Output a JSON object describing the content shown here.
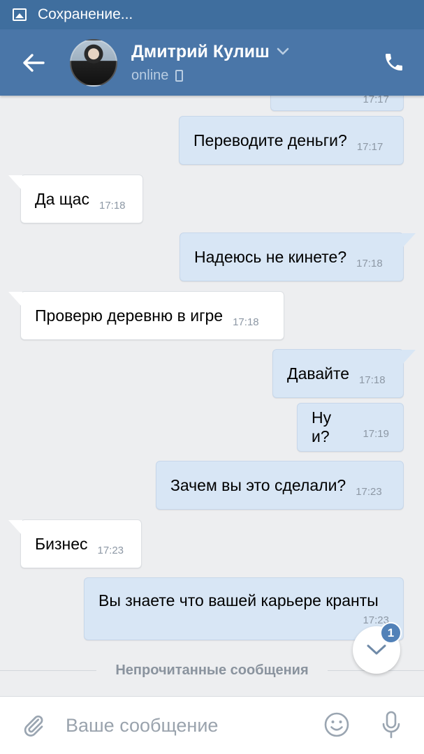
{
  "status_bar": {
    "text": "Сохранение..."
  },
  "header": {
    "contact_name": "Дмитрий Кулиш",
    "presence": "online"
  },
  "messages": [
    {
      "dir": "out",
      "text": "",
      "time": "17:17"
    },
    {
      "dir": "out",
      "text": "Переводите деньги?",
      "time": "17:17"
    },
    {
      "dir": "in",
      "text": "Да щас",
      "time": "17:18"
    },
    {
      "dir": "out",
      "text": "Надеюсь не кинете?",
      "time": "17:18"
    },
    {
      "dir": "in",
      "text": "Проверю деревню в игре",
      "time": "17:18"
    },
    {
      "dir": "out",
      "text": "Давайте",
      "time": "17:18"
    },
    {
      "dir": "out",
      "text": "Ну и?",
      "time": "17:19"
    },
    {
      "dir": "out",
      "text": "Зачем вы это сделали?",
      "time": "17:23"
    },
    {
      "dir": "in",
      "text": "Бизнес",
      "time": "17:23"
    },
    {
      "dir": "out",
      "text": "Вы знаете что вашей карьере кранты",
      "time": "17:23"
    }
  ],
  "unread_divider": "Непрочитанные сообщения",
  "scroll_down": {
    "badge": "1"
  },
  "composer": {
    "placeholder": "Ваше сообщение"
  },
  "colors": {
    "header": "#4a76a8",
    "status_bar": "#3f6e9e",
    "outgoing": "#d8e6f5",
    "incoming": "#ffffff",
    "background": "#edeef0",
    "badge": "#5181b8"
  }
}
